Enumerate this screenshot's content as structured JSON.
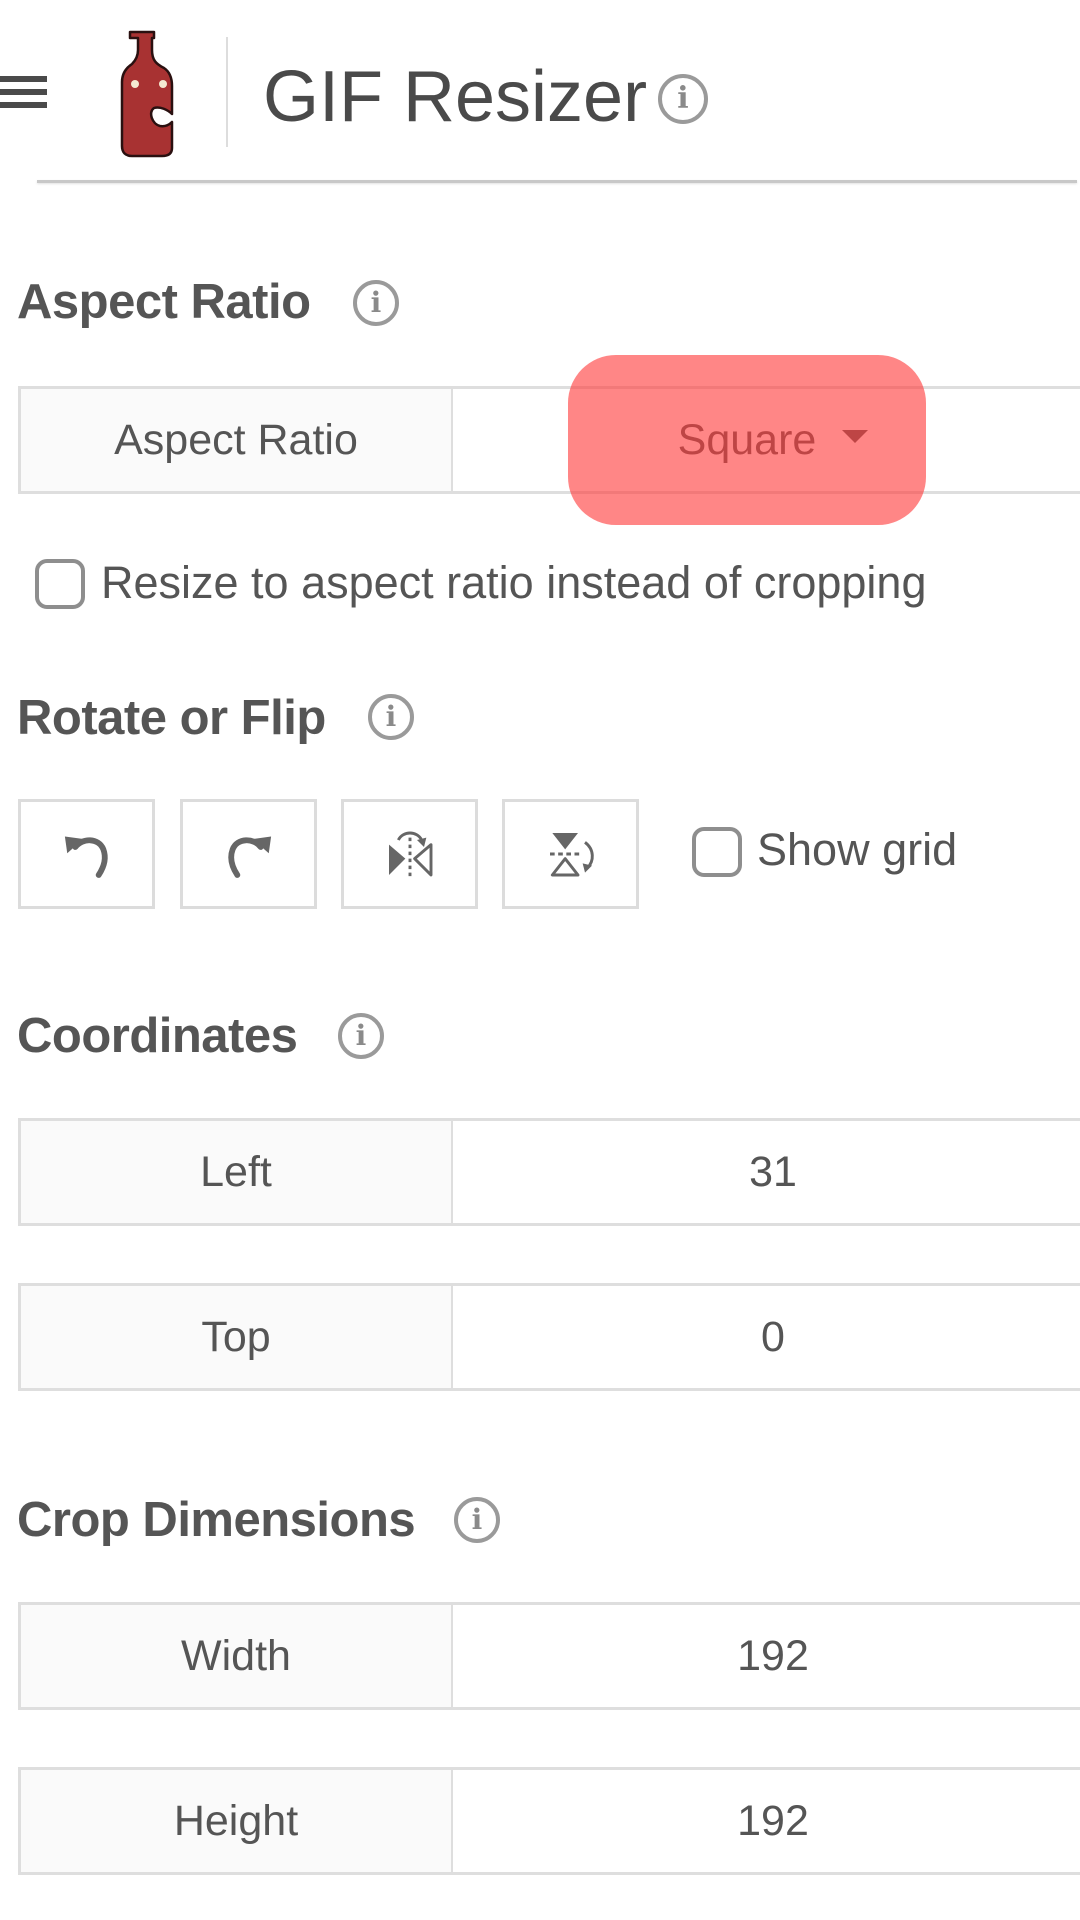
{
  "header": {
    "menu_icon": "hamburger-menu-icon",
    "logo": "red-bottle-logo",
    "title": "GIF Resizer",
    "info_icon": "info-icon"
  },
  "colors": {
    "logo_red": "#a83232",
    "highlight": "#ff7b7b",
    "text": "#555555",
    "border": "#dedede"
  },
  "sections": {
    "aspect_ratio": {
      "title": "Aspect Ratio",
      "rows": [
        {
          "label": "Aspect Ratio",
          "value": "Square",
          "type": "select"
        }
      ],
      "checkbox": {
        "label": "Resize to aspect ratio instead of cropping",
        "checked": false
      }
    },
    "rotate_flip": {
      "title": "Rotate or Flip",
      "buttons": [
        {
          "icon": "rotate-left-icon",
          "action": "Rotate left"
        },
        {
          "icon": "rotate-right-icon",
          "action": "Rotate right"
        },
        {
          "icon": "flip-horizontal-icon",
          "action": "Flip horizontal"
        },
        {
          "icon": "flip-vertical-icon",
          "action": "Flip vertical"
        }
      ],
      "checkbox": {
        "label": "Show grid",
        "checked": false
      }
    },
    "coordinates": {
      "title": "Coordinates",
      "rows": [
        {
          "label": "Left",
          "value": "31"
        },
        {
          "label": "Top",
          "value": "0"
        }
      ]
    },
    "crop_dimensions": {
      "title": "Crop Dimensions",
      "rows": [
        {
          "label": "Width",
          "value": "192"
        },
        {
          "label": "Height",
          "value": "192"
        }
      ]
    }
  }
}
